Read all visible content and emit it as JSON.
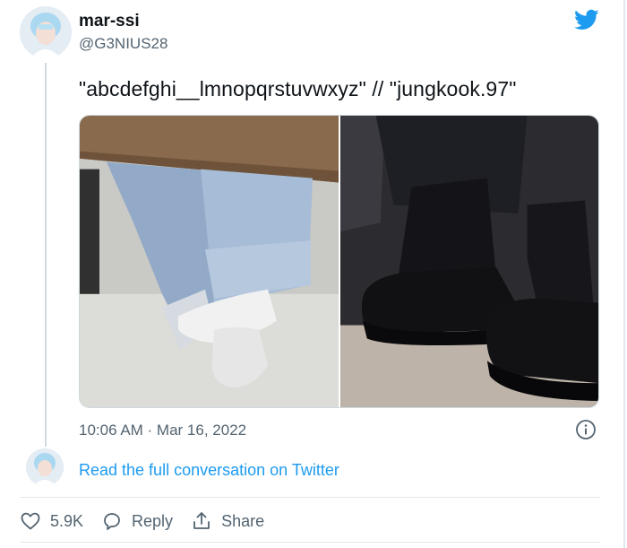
{
  "tweet": {
    "author_name": "mar-ssi",
    "author_handle": "@G3NIUS28",
    "text": "\"abcdefghi__lmnopqrstuvwxyz\" // \"jungkook.97\"",
    "timestamp": "10:06 AM · Mar 16, 2022",
    "read_link": "Read the full conversation on Twitter"
  },
  "actions": {
    "like_count": "5.9K",
    "reply_label": "Reply",
    "share_label": "Share"
  },
  "colors": {
    "accent": "#1d9bf0",
    "muted": "#536471"
  },
  "icons": [
    "twitter-bird-icon",
    "info-icon",
    "heart-icon",
    "reply-icon",
    "share-icon"
  ]
}
